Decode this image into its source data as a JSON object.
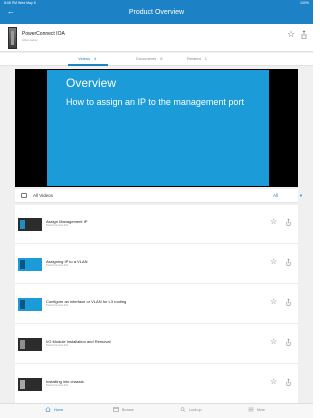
{
  "status_bar": {
    "time_date": "8:05 PM   Wed May 8",
    "battery": "100%"
  },
  "nav": {
    "title": "Product Overview",
    "back_glyph": "←"
  },
  "product": {
    "name": "PowerConnect IOA",
    "subtitle": "Aftermarket",
    "star_glyph": "☆"
  },
  "tabs": [
    {
      "label": "Videos",
      "count": "4"
    },
    {
      "label": "Documents",
      "count": "6"
    },
    {
      "label": "Related",
      "count": "1"
    }
  ],
  "video": {
    "heading": "Overview",
    "subheading": "How to assign an IP to the management port"
  },
  "filter": {
    "label": "All Videos",
    "dropdown": "All",
    "caret": "▼"
  },
  "videos": [
    {
      "title": "Assign Management IP",
      "subtitle": "PowerConnect IOA"
    },
    {
      "title": "Assigning IP to a VLAN",
      "subtitle": "PowerConnect IOA"
    },
    {
      "title": "Configure an interface or VLAN for L3 routing",
      "subtitle": "PowerConnect IOA"
    },
    {
      "title": "I/O Module Installation and Removal",
      "subtitle": "PowerConnect IOA"
    },
    {
      "title": "Installing into chassis",
      "subtitle": "PowerConnect IOA"
    }
  ],
  "bottom_tabs": [
    {
      "label": "Home"
    },
    {
      "label": "Browse"
    },
    {
      "label": "Look up"
    },
    {
      "label": "More"
    }
  ],
  "colors": {
    "brand_blue": "#1d82c5",
    "slide_blue": "#1b9bd7"
  }
}
